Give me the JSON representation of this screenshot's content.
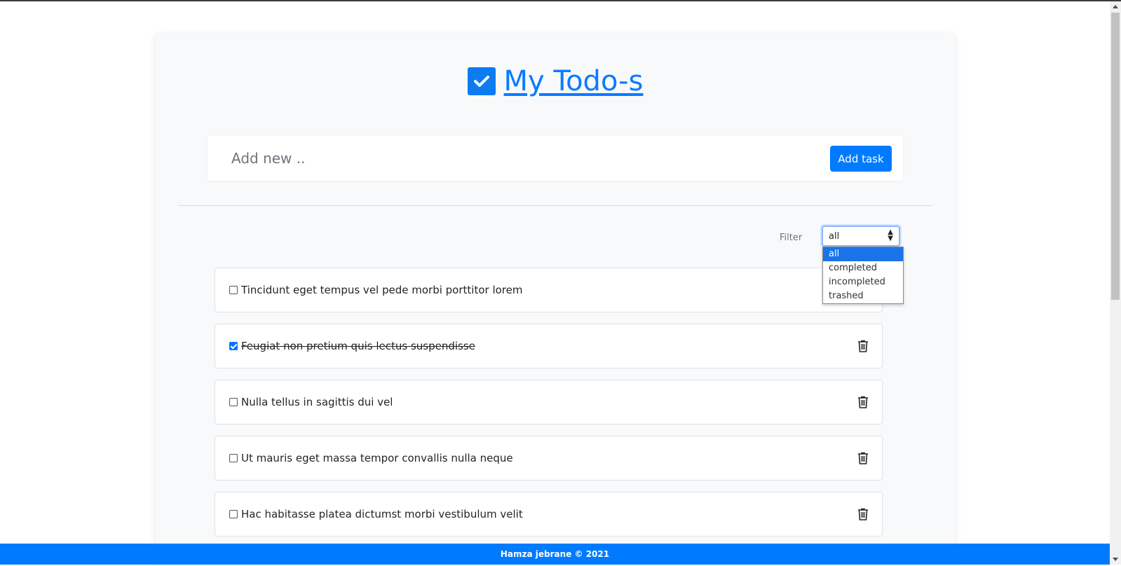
{
  "header": {
    "title": "My Todo-s",
    "logo_icon": "check-square-icon"
  },
  "add_task": {
    "placeholder": "Add new ..",
    "button_label": "Add task"
  },
  "filter": {
    "label": "Filter",
    "selected": "all",
    "options": [
      "all",
      "completed",
      "incompleted",
      "trashed"
    ]
  },
  "todos": [
    {
      "text": "Tincidunt eget tempus vel pede morbi porttitor lorem",
      "completed": false
    },
    {
      "text": "Feugiat non pretium quis lectus suspendisse",
      "completed": true
    },
    {
      "text": "Nulla tellus in sagittis dui vel",
      "completed": false
    },
    {
      "text": "Ut mauris eget massa tempor convallis nulla neque",
      "completed": false
    },
    {
      "text": "Hac habitasse platea dictumst morbi vestibulum velit",
      "completed": false
    }
  ],
  "footer": {
    "text": "Hamza jebrane © 2021"
  },
  "colors": {
    "primary": "#007bff",
    "card_bg": "#f8f9fa"
  }
}
